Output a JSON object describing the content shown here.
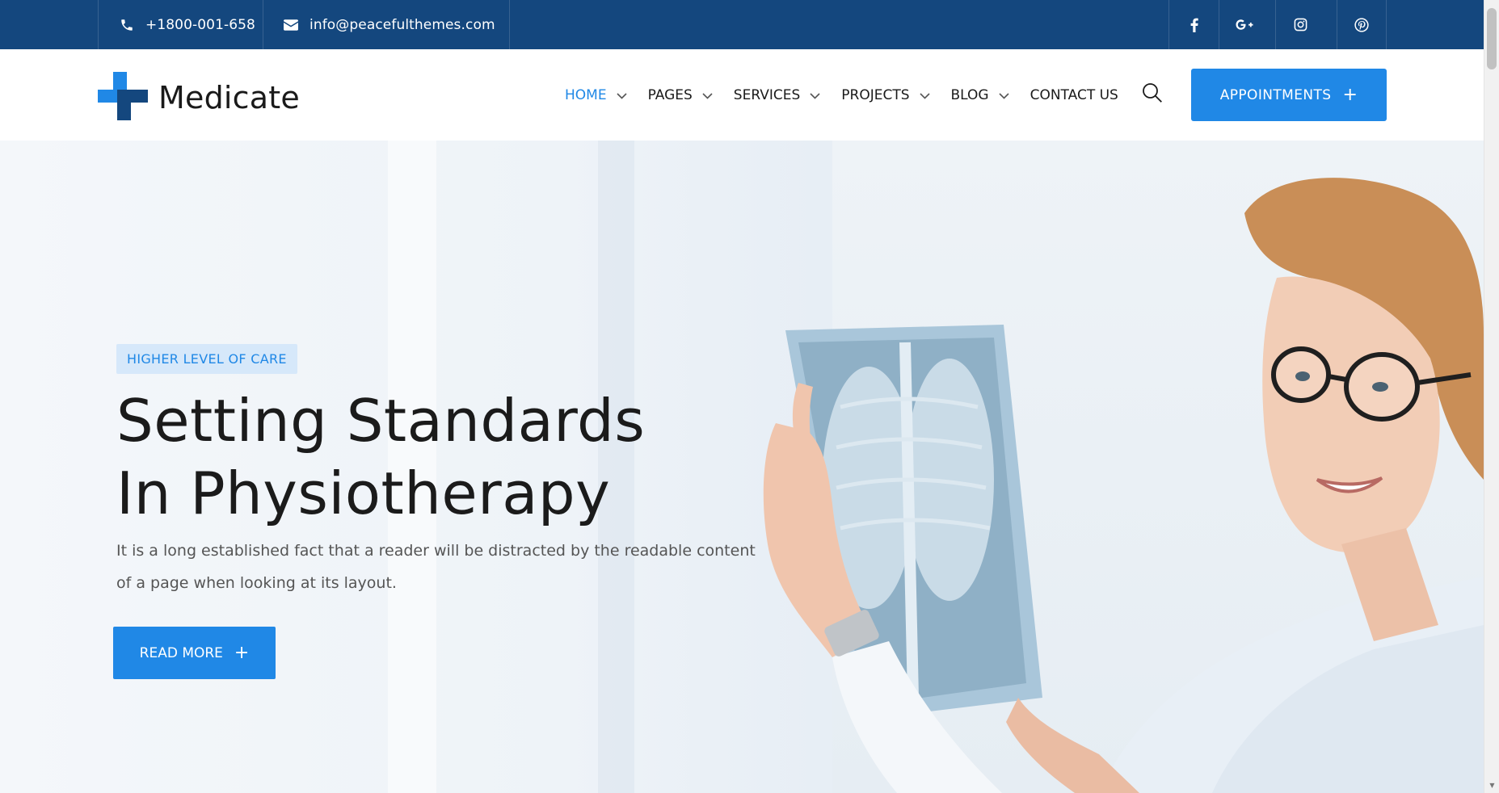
{
  "topbar": {
    "phone": "+1800-001-658",
    "email": "info@peacefulthemes.com",
    "social": [
      "facebook-icon",
      "google-plus-icon",
      "instagram-icon",
      "pinterest-icon"
    ]
  },
  "header": {
    "logo_text": "Medicate",
    "nav": [
      {
        "label": "HOME",
        "active": true,
        "dropdown": true
      },
      {
        "label": "PAGES",
        "dropdown": true
      },
      {
        "label": "SERVICES",
        "dropdown": true
      },
      {
        "label": "PROJECTS",
        "dropdown": true
      },
      {
        "label": "BLOG",
        "dropdown": true
      },
      {
        "label": "CONTACT US",
        "dropdown": false
      }
    ],
    "appointments_label": "APPOINTMENTS",
    "appointments_icon": "+"
  },
  "hero": {
    "tag": "HIGHER LEVEL OF CARE",
    "title_line1": "Setting Standards",
    "title_line2": "In Physiotherapy",
    "description": "It is a long established fact that a reader will be distracted by the readable content of a page when looking at its layout.",
    "button_label": "READ MORE",
    "button_icon": "+"
  },
  "colors": {
    "topbar": "#14477e",
    "accent": "#2088e6",
    "tag_bg": "#d6e8fa",
    "text_dark": "#1b1b1b"
  }
}
